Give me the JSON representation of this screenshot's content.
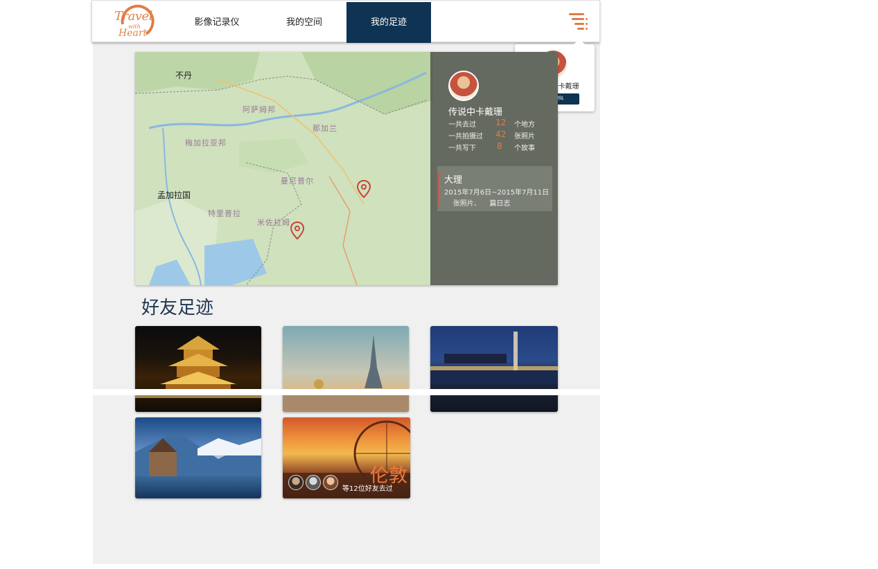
{
  "header": {
    "logo": {
      "line1": "Travel",
      "line2": "with",
      "line3": "Heart"
    },
    "nav": [
      "影像记录仪",
      "我的空间",
      "我的足迹"
    ],
    "active_nav": "我的足迹",
    "menu_icon": "menu-lines-icon"
  },
  "popup": {
    "user_name": "传说中的卡戴珊",
    "logout_label": "退出登陆"
  },
  "map": {
    "labels": {
      "bhutan": "不丹",
      "bangladesh": "孟加拉国",
      "assam": "阿萨姆邦",
      "meghalaya": "梅加拉亚邦",
      "nagaland": "那加兰",
      "manipur": "曼尼普尔",
      "tripura": "特里普拉",
      "mizoram": "米佐拉姆"
    },
    "profile": {
      "name": "传说中卡戴珊",
      "visited_label": "一共去过",
      "visited_value": "12",
      "visited_unit": "个地方",
      "photos_label": "一共拍摄过",
      "photos_value": "42",
      "photos_unit": "张照片",
      "stories_label": "一共写下",
      "stories_value": "8",
      "stories_unit": "个故事"
    },
    "trip": {
      "title": "大理",
      "dates": "2015年7月6日~2015年7月11日",
      "stats": "    张照片、    篇日志"
    },
    "pin_icon": "map-pin-icon"
  },
  "friends": {
    "title": "好友足迹",
    "featured": {
      "city": "伦敦",
      "visited_text": "等12位好友去过"
    }
  },
  "colors": {
    "navy": "#0f3352",
    "accent": "#e07d45"
  }
}
